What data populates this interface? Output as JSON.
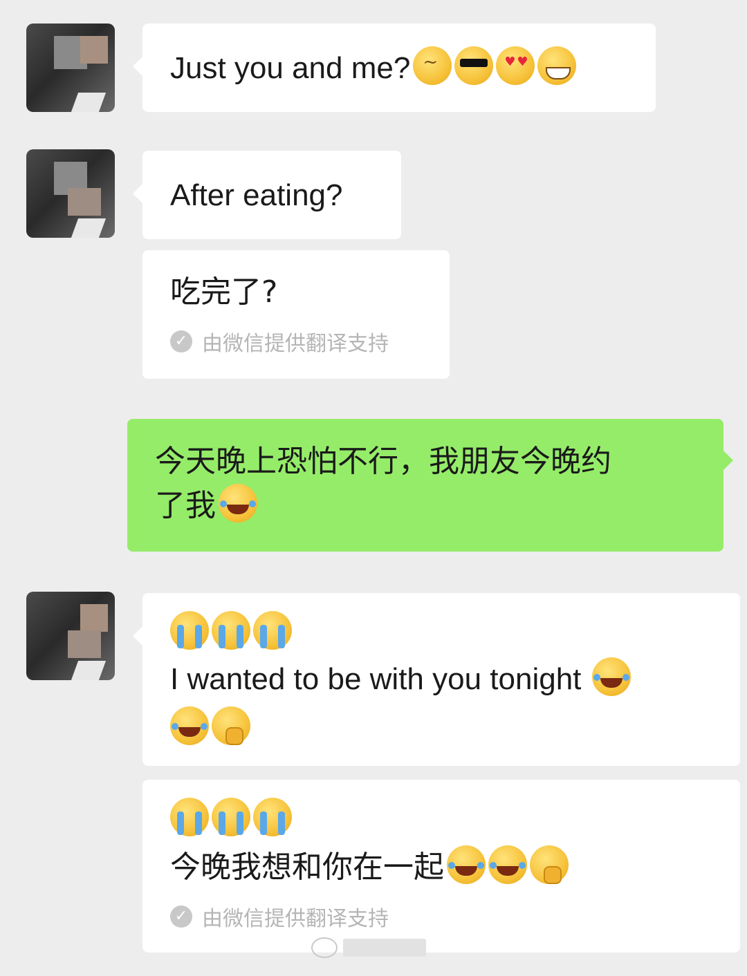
{
  "messages": [
    {
      "sender": "other",
      "text": "Just you and me?",
      "emojis": [
        "wink-emoji",
        "sunglasses-emoji",
        "heart-eyes-emoji",
        "grin-emoji"
      ]
    },
    {
      "sender": "other",
      "text": "After eating?"
    },
    {
      "sender": "other",
      "text": "吃完了?",
      "translation_note": "由微信提供翻译支持"
    },
    {
      "sender": "me",
      "line1": "今天晚上恐怕不行，我朋友今晚约",
      "line2": "了我",
      "emojis": [
        "tears-of-joy-emoji"
      ]
    },
    {
      "sender": "other",
      "lead_emojis": [
        "crying-emoji",
        "crying-emoji",
        "crying-emoji"
      ],
      "text": "I wanted to be with you tonight",
      "trail_emojis": [
        "laughing-emoji",
        "laughing-emoji",
        "covering-mouth-emoji"
      ]
    },
    {
      "sender": "other",
      "lead_emojis": [
        "crying-emoji",
        "crying-emoji",
        "crying-emoji"
      ],
      "text": "今晚我想和你在一起",
      "trail_emojis": [
        "laughing-emoji",
        "laughing-emoji",
        "covering-mouth-emoji"
      ],
      "translation_note": "由微信提供翻译支持"
    }
  ],
  "colors": {
    "background": "#ededed",
    "bubble_other": "#ffffff",
    "bubble_me": "#95ec69",
    "note_text": "#b5b5b5"
  }
}
